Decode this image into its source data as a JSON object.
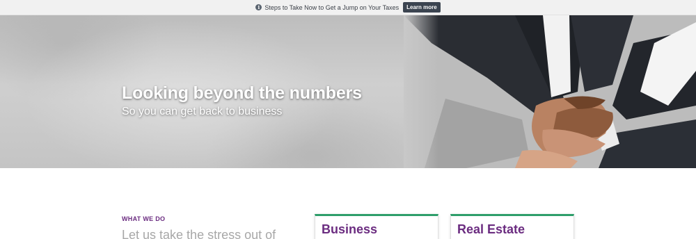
{
  "announcement": {
    "icon": "info-icon",
    "message": "Steps to Take Now to Get a Jump on Your Taxes",
    "button_label": "Learn more"
  },
  "hero": {
    "title": "Looking beyond the numbers",
    "subtitle": "So you can get back to business",
    "image": "team-hands-stacked-photo"
  },
  "what_we_do": {
    "label": "WHAT WE DO",
    "heading": "Let us take the stress out of"
  },
  "cards": [
    {
      "title": "Business"
    },
    {
      "title": "Real Estate"
    }
  ],
  "colors": {
    "accent_purple": "#6b2c80",
    "card_border_green": "#2e9e6a",
    "button_dark": "#3b4450"
  }
}
